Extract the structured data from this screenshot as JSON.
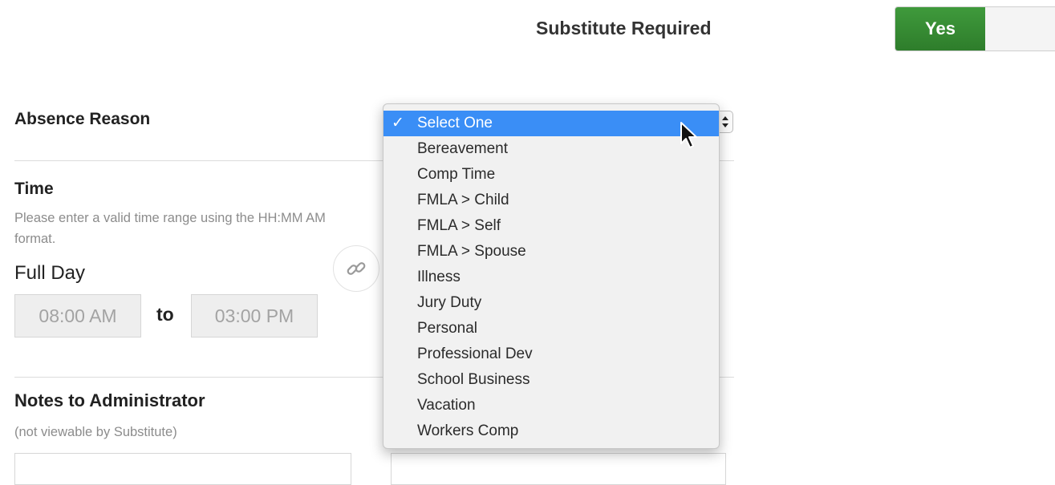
{
  "substitute": {
    "label": "Substitute Required",
    "toggle_on_label": "Yes"
  },
  "absence": {
    "heading": "Absence Reason",
    "options": [
      "Select One",
      "Bereavement",
      "Comp Time",
      "FMLA > Child",
      "FMLA > Self",
      "FMLA > Spouse",
      "Illness",
      "Jury Duty",
      "Personal",
      "Professional Dev",
      "School Business",
      "Vacation",
      "Workers Comp"
    ],
    "selected_check": "✓"
  },
  "time": {
    "heading": "Time",
    "help_text": "Please enter a valid time range using the HH:MM AM format.",
    "full_day_label": "Full Day",
    "start_value": "08:00 AM",
    "to_label": "to",
    "end_value": "03:00 PM"
  },
  "notes": {
    "heading": "Notes to Administrator",
    "subtext": "(not viewable by Substitute)"
  },
  "colors": {
    "toggle_green": "#2e7d2b",
    "menu_highlight": "#3a8ef6"
  },
  "icons": {
    "link": "link-icon",
    "select_arrows": "select-arrows-icon",
    "cursor": "mouse-pointer-icon"
  }
}
